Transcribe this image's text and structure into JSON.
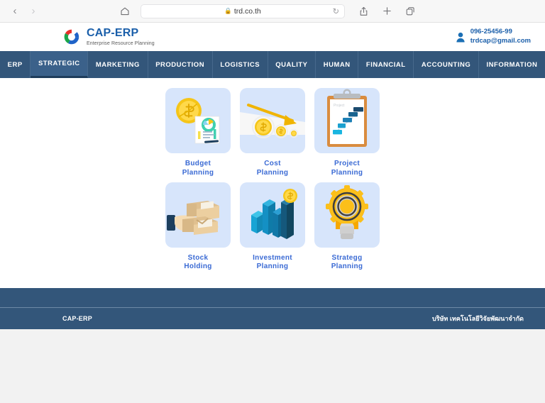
{
  "browser": {
    "back_label": "‹",
    "forward_label": "›",
    "home_icon": "home-icon",
    "url": "trd.co.th",
    "lock_glyph": "🔒",
    "reload_glyph": "↻",
    "share_icon": "share-icon",
    "new_tab_label": "+",
    "tabs_icon": "tabs-icon"
  },
  "header": {
    "brand_title": "CAP-ERP",
    "brand_subtitle": "Enterprise Resource Planning",
    "contact": {
      "phone": "096-25456-99",
      "email": "trdcap@gmail.com"
    }
  },
  "nav": {
    "items": [
      {
        "label": "ERP",
        "active": false
      },
      {
        "label": "STRATEGIC",
        "active": true
      },
      {
        "label": "MARKETING",
        "active": false
      },
      {
        "label": "PRODUCTION",
        "active": false
      },
      {
        "label": "LOGISTICS",
        "active": false
      },
      {
        "label": "QUALITY",
        "active": false
      },
      {
        "label": "HUMAN",
        "active": false
      },
      {
        "label": "FINANCIAL",
        "active": false
      },
      {
        "label": "ACCOUNTING",
        "active": false
      },
      {
        "label": "INFORMATION",
        "active": false
      }
    ]
  },
  "tiles": [
    {
      "line1": "Budget",
      "line2": "Planning",
      "icon": "coin-chart-document-icon"
    },
    {
      "line1": "Cost",
      "line2": "Planning",
      "icon": "declining-arrow-coins-icon"
    },
    {
      "line1": "Project",
      "line2": "Planning",
      "icon": "clipboard-gantt-icon"
    },
    {
      "line1": "Stock",
      "line2": "Holding",
      "icon": "hand-holding-boxes-icon"
    },
    {
      "line1": "Investment",
      "line2": "Planning",
      "icon": "bar-chart-coin-icon"
    },
    {
      "line1": "Strategg",
      "line2": "Planning",
      "icon": "lightbulb-gear-icon"
    }
  ],
  "footer": {
    "left": "CAP-ERP",
    "right": "บริษัท เทคโนโลยีวิจัยพัฒนาจำกัด"
  },
  "colors": {
    "nav_bg": "#33567a",
    "nav_active_bg": "#3b618a",
    "brand_blue": "#1b5faa",
    "tile_bg": "#d7e5fb",
    "tile_label": "#3a6ad4"
  }
}
